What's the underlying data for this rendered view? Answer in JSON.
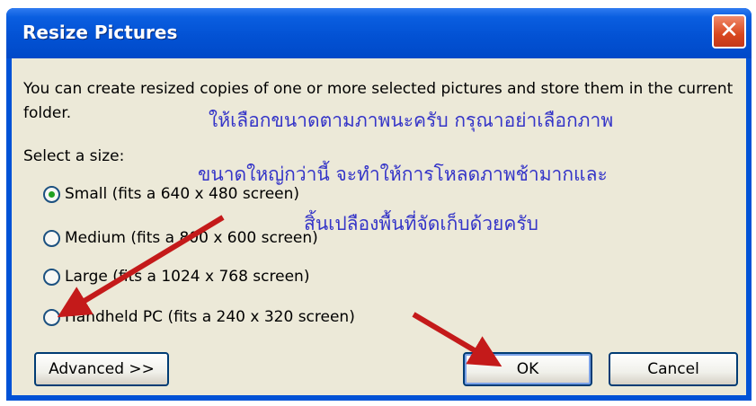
{
  "window": {
    "title": "Resize Pictures",
    "close_glyph": "✕"
  },
  "description": "You can create resized copies of one or more selected pictures and store them in the current folder.",
  "annotation": {
    "line1": "ให้เลือกขนาดตามภาพนะครับ กรุณาอย่าเลือกภาพ",
    "line2": "ขนาดใหญ่กว่านี้ จะทำให้การโหลดภาพช้ามากและ",
    "line3": "สิ้นเปลืองพื้นที่จัดเก็บด้วยครับ"
  },
  "size_group": {
    "label": "Select a size:",
    "options": [
      {
        "label": "Small (fits a 640 x 480 screen)",
        "selected": true
      },
      {
        "label": "Medium (fits a 800 x 600 screen)",
        "selected": false
      },
      {
        "label": "Large (fits a 1024 x 768 screen)",
        "selected": false
      },
      {
        "label": "Handheld PC (fits a 240 x 320 screen)",
        "selected": false
      }
    ]
  },
  "buttons": {
    "advanced": "Advanced >>",
    "ok": "OK",
    "cancel": "Cancel"
  },
  "colors": {
    "titlebar": "#0352d4",
    "client": "#ece9d8",
    "annotation_text": "#3535c8",
    "arrow": "#c41a1a",
    "radio_dot": "#21a121"
  }
}
